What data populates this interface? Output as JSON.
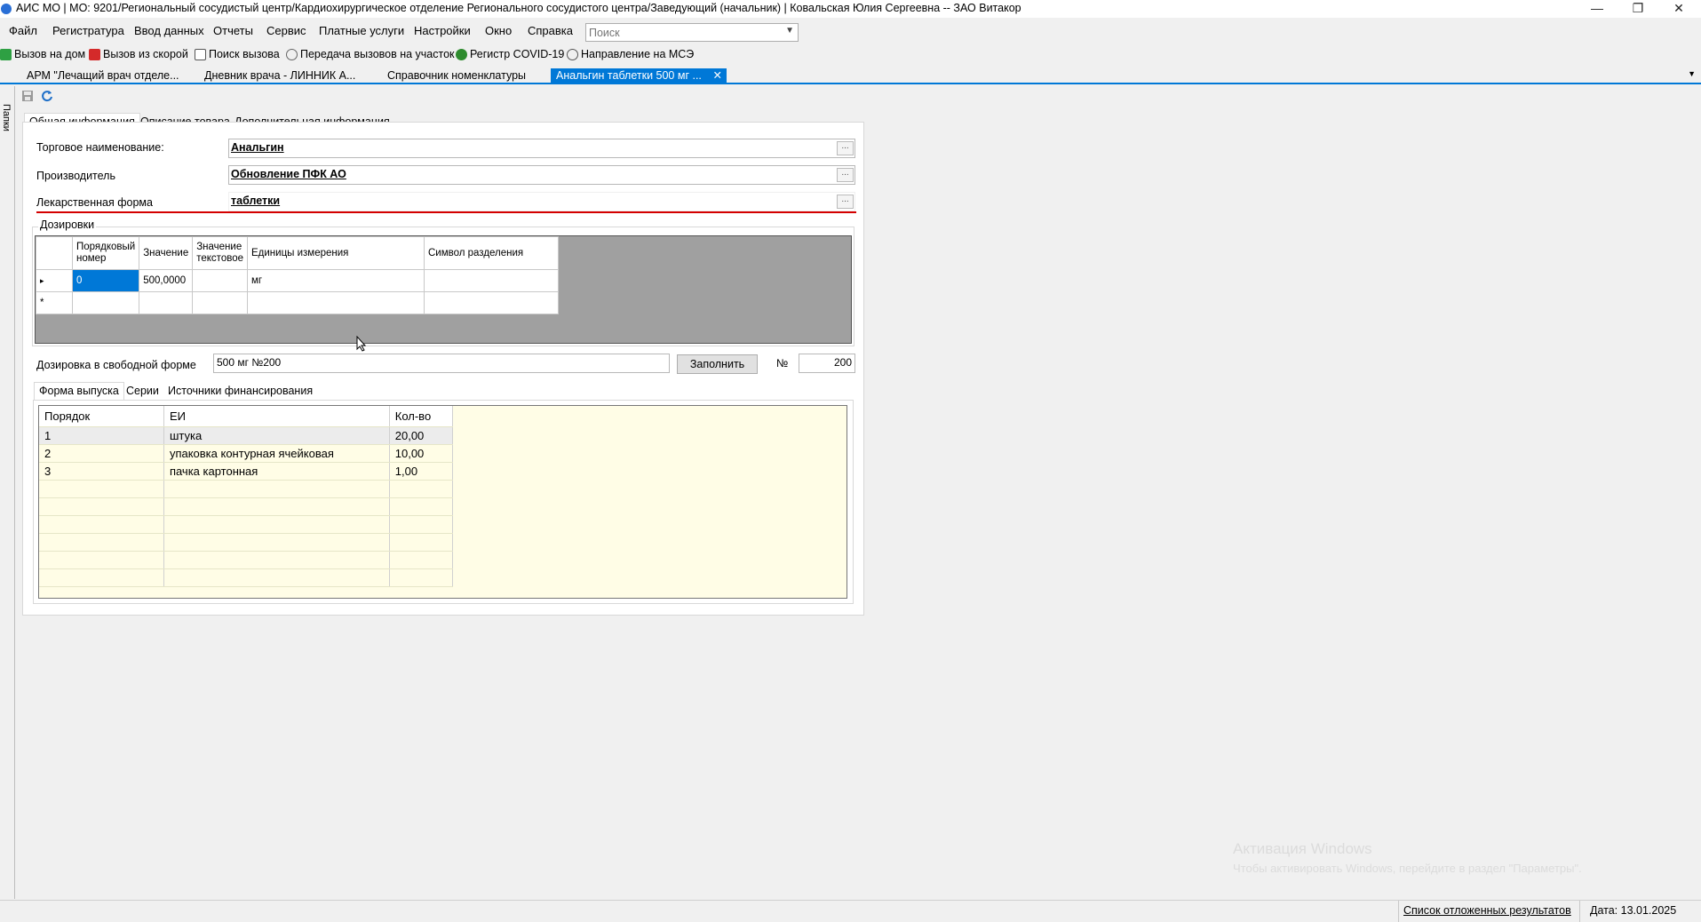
{
  "window": {
    "title": "АИС МО | МО: 9201/Региональный сосудистый центр/Кардиохирургическое отделение Регионального сосудистого центра/Заведующий (начальник) | Ковальская Юлия Сергеевна -- ЗАО Витакор",
    "minimize": "—",
    "maximize": "❐",
    "close": "✕"
  },
  "menu": [
    "Файл",
    "Регистратура",
    "Ввод данных",
    "Отчеты",
    "Сервис",
    "Платные услуги",
    "Настройки",
    "Окно",
    "Справка"
  ],
  "search": {
    "placeholder": "Поиск"
  },
  "toolbar": {
    "items": [
      {
        "label": "Вызов на дом",
        "icon": "check-green-icon"
      },
      {
        "label": "Вызов из скорой",
        "icon": "check-red-icon"
      },
      {
        "label": "Поиск вызова",
        "icon": "search-doc-icon"
      },
      {
        "label": "Передача вызовов на участок",
        "icon": "transfer-icon"
      },
      {
        "label": "Регистр COVID-19",
        "icon": "virus-icon"
      },
      {
        "label": "Направление на МСЭ",
        "icon": "direction-icon"
      }
    ]
  },
  "doc_tabs": [
    {
      "label": "АРМ \"Лечащий врач отделе..."
    },
    {
      "label": "Дневник врача - ЛИННИК А..."
    },
    {
      "label": "Справочник номенклатуры"
    },
    {
      "label": "Анальгин таблетки 500 мг ...",
      "active": true
    }
  ],
  "left_strip": {
    "label": "Папки"
  },
  "form": {
    "tabs": [
      "Общая информация",
      "Описание товара",
      "Дополнительная информация"
    ],
    "trade_name_label": "Торговое наименование:",
    "trade_name_value": "Анальгин",
    "manufacturer_label": "Производитель",
    "manufacturer_value": "Обновление ПФК АО",
    "dosage_form_label": "Лекарственная форма",
    "dosage_form_value": "таблетки",
    "ellipsis": "...",
    "dosages_group_label": "Дозировки",
    "dosages_columns": [
      "Порядковый номер",
      "Значение",
      "Значение текстовое",
      "Единицы измерения",
      "Символ разделения"
    ],
    "dosages_rows": [
      {
        "marker": "▸",
        "order": "0",
        "value": "500,0000",
        "text_value": "",
        "unit": "мг",
        "separator": ""
      },
      {
        "marker": "*",
        "order": "",
        "value": "",
        "text_value": "",
        "unit": "",
        "separator": ""
      }
    ],
    "free_dosage_label": "Дозировка в свободной форме",
    "free_dosage_value": "500 мг №200",
    "fill_button": "Заполнить",
    "number_label": "№",
    "number_value": "200",
    "inner_tabs": [
      "Форма выпуска",
      "Серии",
      "Источники финансирования"
    ],
    "release_columns": [
      "Порядок",
      "ЕИ",
      "Кол-во"
    ],
    "release_rows": [
      {
        "order": "1",
        "unit": "штука",
        "qty": "20,00"
      },
      {
        "order": "2",
        "unit": "упаковка контурная ячейковая",
        "qty": "10,00"
      },
      {
        "order": "3",
        "unit": "пачка картонная",
        "qty": "1,00"
      }
    ]
  },
  "status": {
    "deferred_results": "Список отложенных результатов",
    "date": "Дата: 13.01.2025"
  },
  "activation": {
    "line1": "Активация Windows",
    "line2": "Чтобы активировать Windows, перейдите в раздел \"Параметры\"."
  },
  "colors": {
    "accent": "#0078d7",
    "error_underline": "#d40000",
    "grid_bg": "#fffde6"
  }
}
